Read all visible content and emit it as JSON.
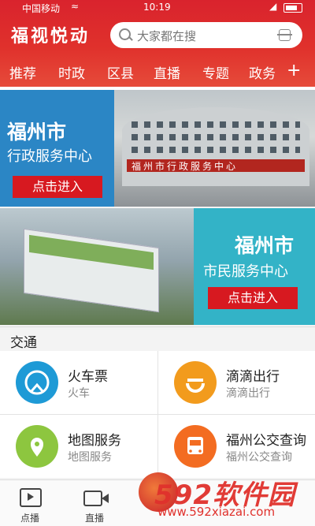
{
  "status_bar": {
    "carrier": "中国移动",
    "time": "10:19"
  },
  "header": {
    "logo": "福视悦动",
    "search_placeholder": "大家都在搜"
  },
  "tabs": [
    "推荐",
    "时政",
    "区县",
    "直播",
    "专题",
    "政务"
  ],
  "banners": [
    {
      "title": "福州市",
      "subtitle": "行政服务中心",
      "button": "点击进入",
      "photo_sign": "福州市行政服务中心",
      "accent": "#2b86c5"
    },
    {
      "title": "福州市",
      "subtitle": "市民服务中心",
      "button": "点击进入",
      "accent": "#33b3c7"
    }
  ],
  "section_title": "交通",
  "services": [
    {
      "title": "火车票",
      "subtitle": "火车",
      "icon": "train-icon",
      "color": "#1e9ad6"
    },
    {
      "title": "滴滴出行",
      "subtitle": "滴滴出行",
      "icon": "didi-icon",
      "color": "#f29b1d"
    },
    {
      "title": "地图服务",
      "subtitle": "地图服务",
      "icon": "map-pin-icon",
      "color": "#8dc63f"
    },
    {
      "title": "福州公交查询",
      "subtitle": "福州公交查询",
      "icon": "bus-icon",
      "color": "#f36c21"
    }
  ],
  "bottom_nav": [
    "点播",
    "直播"
  ],
  "watermark": {
    "main": "592软件园",
    "url": "www.592xiazai.com"
  }
}
